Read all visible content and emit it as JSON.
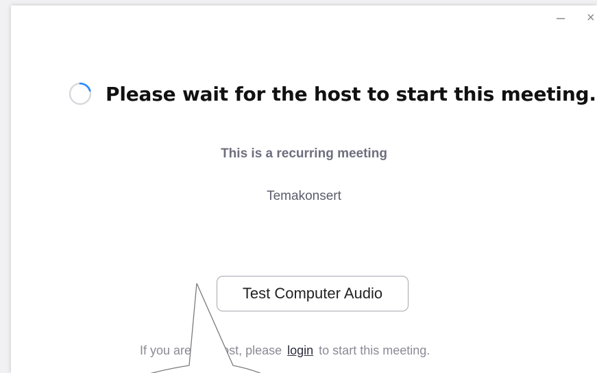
{
  "window": {
    "minimize_glyph": "–",
    "close_glyph": "×"
  },
  "main": {
    "headline": "Please wait for the host to start this meeting.",
    "subtitle": "This is a recurring meeting",
    "meeting_name": "Temakonsert",
    "test_audio_label": "Test Computer Audio"
  },
  "footer": {
    "prefix": "If you are the host, please",
    "link": "login",
    "suffix": "to start this meeting."
  },
  "icons": {
    "spinner": "loading-spinner-icon",
    "callout": "speech-callout-shape"
  },
  "colors": {
    "spinner_accent": "#2d8cff",
    "spinner_track": "#d9d9de",
    "button_border": "#a7a7ad"
  }
}
